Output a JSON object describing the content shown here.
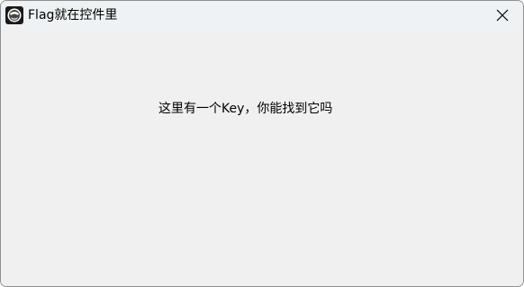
{
  "window": {
    "title": "Flag就在控件里",
    "app_icon": "app-logo-icon",
    "close_icon": "close-icon"
  },
  "content": {
    "label": "这里有一个Key，你能找到它吗"
  }
}
